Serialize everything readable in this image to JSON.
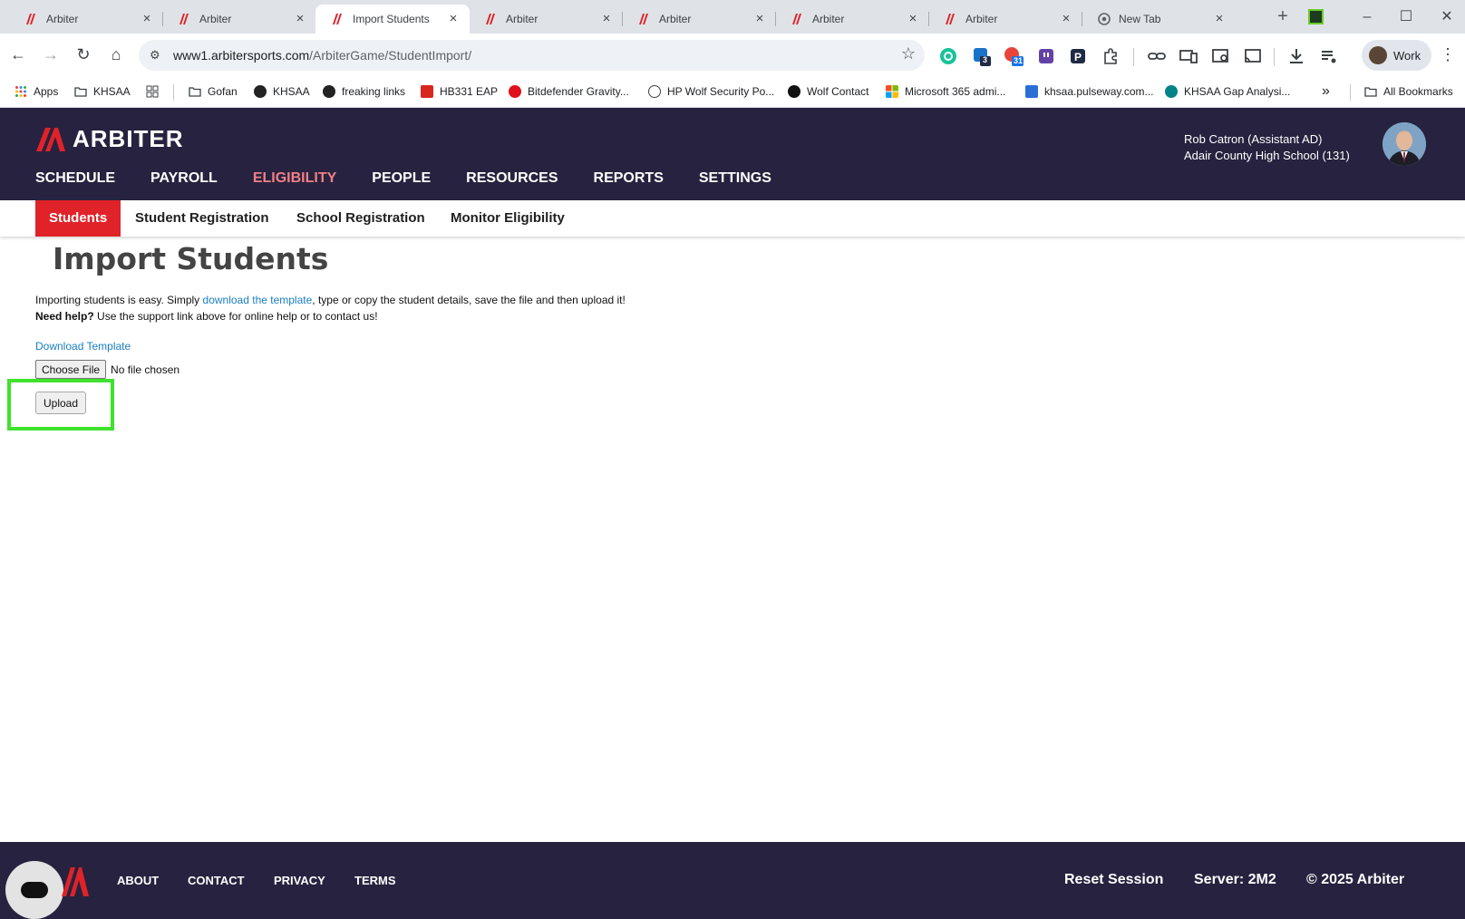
{
  "browser": {
    "tabs": [
      {
        "label": "Arbiter",
        "active": false,
        "icon": "arbiter-favicon"
      },
      {
        "label": "Arbiter",
        "active": false,
        "icon": "arbiter-favicon"
      },
      {
        "label": "Import Students",
        "active": true,
        "icon": "arbiter-favicon"
      },
      {
        "label": "Arbiter",
        "active": false,
        "icon": "arbiter-favicon"
      },
      {
        "label": "Arbiter",
        "active": false,
        "icon": "arbiter-favicon"
      },
      {
        "label": "Arbiter",
        "active": false,
        "icon": "arbiter-favicon"
      },
      {
        "label": "Arbiter",
        "active": false,
        "icon": "arbiter-favicon"
      },
      {
        "label": "New Tab",
        "active": false,
        "icon": "chrome-favicon"
      }
    ],
    "url_host": "www1.arbitersports.com",
    "url_path": "/ArbiterGame/StudentImport/",
    "profile_label": "Work",
    "ext_badges": {
      "outlook": "3",
      "calendar": "31"
    },
    "bookmarks": [
      {
        "label": "Apps",
        "icon": "apps-grid-icon"
      },
      {
        "label": "KHSAA",
        "icon": "folder-icon"
      },
      {
        "label": "",
        "icon": "grid-icon"
      },
      {
        "label": "Gofan",
        "icon": "folder-icon"
      },
      {
        "label": "KHSAA",
        "icon": "khsaa-icon"
      },
      {
        "label": "freaking links",
        "icon": "khsaa-icon"
      },
      {
        "label": "HB331 EAP",
        "icon": "pdf-icon"
      },
      {
        "label": "Bitdefender Gravity...",
        "icon": "bitdefender-icon"
      },
      {
        "label": "HP Wolf Security Po...",
        "icon": "hp-icon"
      },
      {
        "label": "Wolf Contact",
        "icon": "wolf-icon"
      },
      {
        "label": "Microsoft 365 admi...",
        "icon": "microsoft-icon"
      },
      {
        "label": "khsaa.pulseway.com...",
        "icon": "pulseway-icon"
      },
      {
        "label": "KHSAA Gap Analysi...",
        "icon": "sharepoint-icon"
      }
    ],
    "bookmarks_overflow": "»",
    "all_bookmarks": "All Bookmarks"
  },
  "header": {
    "brand": "ARBITER",
    "nav": [
      "SCHEDULE",
      "PAYROLL",
      "ELIGIBILITY",
      "PEOPLE",
      "RESOURCES",
      "REPORTS",
      "SETTINGS"
    ],
    "active_nav": "ELIGIBILITY",
    "user_name": "Rob Catron (Assistant AD)",
    "user_school": "Adair County High School (131)"
  },
  "subnav": [
    "Students",
    "Student Registration",
    "School Registration",
    "Monitor Eligibility"
  ],
  "content": {
    "title": "Import Students",
    "intro_prefix": "Importing students is easy. Simply ",
    "intro_link": "download the template",
    "intro_suffix": ", type or copy the student details, save the file and then upload it!",
    "help_bold": "Need help?",
    "help_text": " Use the support link above for online help or to contact us!",
    "download_link": "Download Template",
    "choose_file_label": "Choose File",
    "no_file_text": "No file chosen",
    "upload_label": "Upload"
  },
  "footer": {
    "links": [
      "ABOUT",
      "CONTACT",
      "PRIVACY",
      "TERMS"
    ],
    "reset_session": "Reset Session",
    "server": "Server: 2M2",
    "copyright": "© 2025 Arbiter"
  },
  "colors": {
    "header_bg": "#27223f",
    "brand_red": "#e02229",
    "active_nav": "#f08086",
    "link": "#1a7ec2",
    "highlight": "#3fe22c"
  }
}
